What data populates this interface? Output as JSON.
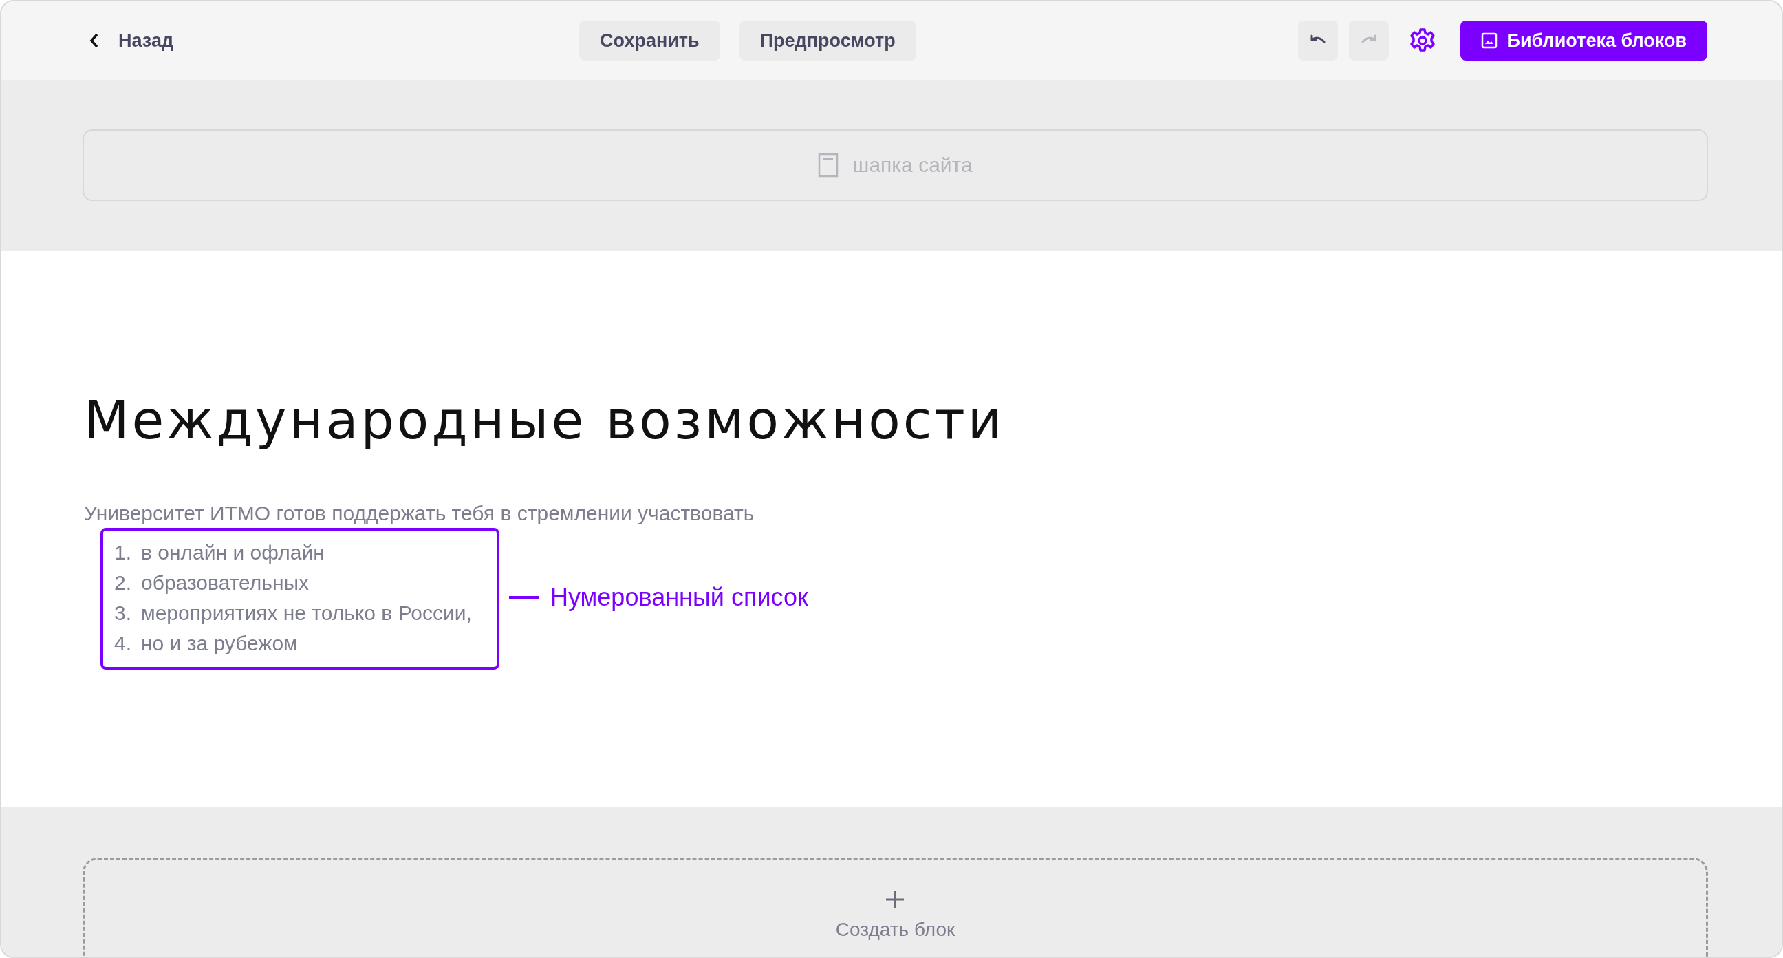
{
  "toolbar": {
    "back": "Назад",
    "buttons": [
      {
        "label": "Сохранить"
      },
      {
        "label": "Предпросмотр"
      }
    ],
    "undo": {
      "disabled": false
    },
    "redo": {
      "disabled": true
    },
    "library": "Библиотека блоков"
  },
  "header_block": {
    "label": "шапка сайта"
  },
  "content": {
    "title": "Международные возможности",
    "intro": "Университет ИТМО готов поддержать тебя в стремлении участвовать",
    "list": [
      {
        "number": "1.",
        "text": "в онлайн и офлайн"
      },
      {
        "number": "2.",
        "text": "образовательных"
      },
      {
        "number": "3.",
        "text": "мероприятиях не только в России,"
      },
      {
        "number": "4.",
        "text": "но и за рубежом"
      }
    ],
    "annotation": "Нумерованный список"
  },
  "create_block": {
    "label": "Создать блок"
  }
}
